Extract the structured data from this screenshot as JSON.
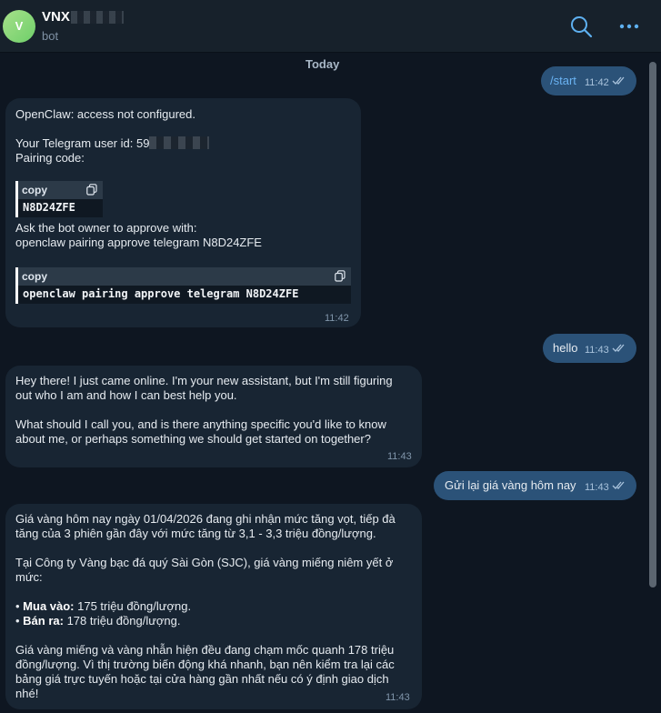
{
  "header": {
    "avatar_letter": "V",
    "title": "VNX",
    "subtitle": "bot"
  },
  "date_chip": "Today",
  "messages": [
    {
      "from": "out",
      "text": "/start",
      "time": "11:42"
    },
    {
      "from": "in",
      "intro": "OpenClaw: access not configured.",
      "user_id_label": "Your Telegram user id: 59",
      "pairing_label": "Pairing code:",
      "copy_label": "copy",
      "code1": "N8D24ZFE",
      "approve_line1": "Ask the bot owner to approve with:",
      "approve_line2": "openclaw pairing approve telegram N8D24ZFE",
      "copy_label2": "copy",
      "code2": "openclaw pairing approve telegram N8D24ZFE",
      "time": "11:42"
    },
    {
      "from": "out",
      "text": "hello",
      "time": "11:43"
    },
    {
      "from": "in",
      "text": "Hey there! I just came online. I'm your new assistant, but I'm still figuring\nout who I am and how I can best help you.\n\nWhat should I call you, and is there anything specific you'd like to know\nabout me, or perhaps something we should get started on together?",
      "time": "11:43"
    },
    {
      "from": "out",
      "text": "Gửi lại giá vàng hôm nay",
      "time": "11:43"
    },
    {
      "from": "in",
      "p1": "Giá vàng hôm nay ngày 01/04/2026 đang ghi nhận mức tăng vọt, tiếp đà\ntăng của 3 phiên gần đây với mức tăng từ 3,1 - 3,3 triệu đồng/lượng.",
      "p2": "Tại Công ty Vàng bạc đá quý Sài Gòn (SJC), giá vàng miếng niêm yết ở\nmức:",
      "buy_label": "Mua vào:",
      "buy_value": " 175 triệu đồng/lượng.",
      "sell_label": "Bán ra:",
      "sell_value": " 178 triệu đồng/lượng.",
      "p3": "Giá vàng miếng và vàng nhẫn hiện đều đang chạm mốc quanh 178 triệu\nđồng/lượng. Vì thị trường biến động khá nhanh, bạn nên kiểm tra lại các\nbảng giá trực tuyến hoặc tại cửa hàng gần nhất nếu có ý định giao dịch\nnhé!",
      "time": "11:43"
    }
  ],
  "icons": [
    "search-icon",
    "more-icon",
    "copy-icon",
    "double-check-icon"
  ],
  "colors": {
    "background": "#0e1621",
    "header": "#17212b",
    "incoming": "#182533",
    "outgoing": "#2b5278",
    "link": "#6ab3f3"
  }
}
